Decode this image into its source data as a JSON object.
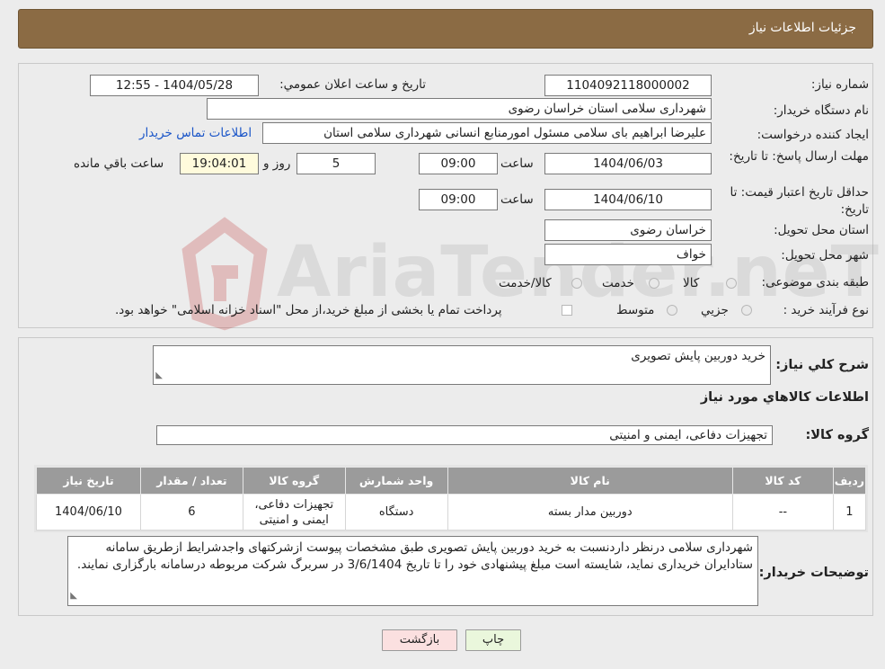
{
  "header": {
    "title": "جزئیات اطلاعات نیاز"
  },
  "form": {
    "need_number_label": "شماره نیاز:",
    "need_number": "1104092118000002",
    "announce_label": "تاريخ و ساعت اعلان عمومي:",
    "announce_value": "1404/05/28 - 12:55",
    "buyer_org_label": "نام دستگاه خريدار:",
    "buyer_org": "شهرداری سلامی استان خراسان رضوی",
    "creator_label": "ايجاد کننده درخواست:",
    "creator": "علیرضا ابراهیم بای سلامی مسئول امورمنابع انسانی  شهرداری سلامی استان",
    "contact_link": "اطلاعات تماس خريدار",
    "deadline_label": "مهلت ارسال پاسخ: تا تاريخ:",
    "deadline_date": "1404/06/03",
    "time_word": "ساعت",
    "deadline_time": "09:00",
    "days_remaining": "5",
    "days_word": "روز و",
    "time_remaining": "19:04:01",
    "remaining_word": "ساعت باقي مانده",
    "validity_label": "حداقل تاريخ اعتبار قيمت: تا تاريخ:",
    "validity_date": "1404/06/10",
    "validity_time": "09:00",
    "province_label": "استان محل تحويل:",
    "province": "خراسان رضوی",
    "city_label": "شهر محل تحويل:",
    "city": "خواف",
    "category_label": "طبقه بندی موضوعی:",
    "category_options": [
      "کالا",
      "خدمت",
      "کالا/خدمت"
    ],
    "purchase_type_label": "نوع فرآيند خريد :",
    "purchase_type_options": [
      "جزيي",
      "متوسط"
    ],
    "payment_note": "پرداخت تمام يا بخشی از مبلغ خريد،از محل \"اسناد خزانه اسلامی\" خواهد بود."
  },
  "summary": {
    "label": "شرح کلي نياز:",
    "value": "خرید دوربین پایش تصویری",
    "goods_info_title": "اطلاعات کالاهاي مورد نياز",
    "group_label": "گروه کالا:",
    "group_value": "تجهیزات دفاعی، ایمنی و امنیتی"
  },
  "table": {
    "headers": [
      "رديف",
      "کد کالا",
      "نام کالا",
      "واحد شمارش",
      "گروه کالا",
      "تعداد / مقدار",
      "تاريخ نياز"
    ],
    "rows": [
      [
        "1",
        "--",
        "دوربین مدار بسته",
        "دستگاه",
        "تجهیزات دفاعی، ایمنی و امنیتی",
        "6",
        "1404/06/10"
      ]
    ]
  },
  "notes": {
    "label": "توضيحات خريدار:",
    "text": "شهرداری سلامی درنظر داردنسبت به خرید دوربین پایش تصویری  طبق مشخصات پیوست ازشرکتهای واجدشرایط ازطریق سامانه ستادایران خریداری نماید، شایسته است مبلغ پیشنهادی خود را تا تاریخ 3/6/1404  در سربرگ شرکت مربوطه درسامانه بارگزاری نمایند."
  },
  "buttons": {
    "print": "چاپ",
    "back": "بازگشت"
  },
  "watermark": {
    "text": "AriaTender.neT"
  },
  "colors": {
    "header": "#8b6b44",
    "link": "#1a55c8",
    "print_btn": "#eaf7dc",
    "back_btn": "#fbe0e0"
  }
}
